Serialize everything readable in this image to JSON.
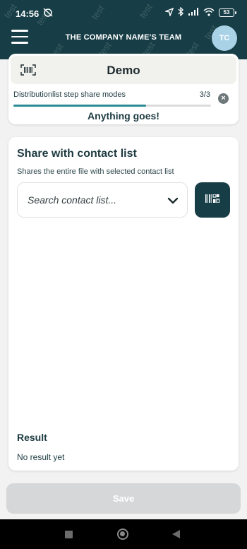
{
  "status_bar": {
    "time": "14:56",
    "battery": "53"
  },
  "header": {
    "title": "THE COMPANY NAME'S TEAM",
    "avatar_initials": "TC",
    "watermark": "test"
  },
  "demo": {
    "title": "Demo",
    "step_label": "Distributionlist step share modes",
    "step_count": "3/3",
    "step_progress": 0.67,
    "message": "Anything goes!"
  },
  "share": {
    "title": "Share with contact list",
    "subtitle": "Shares the entire file with selected contact list",
    "search_placeholder": "Search contact list..."
  },
  "result": {
    "title": "Result",
    "value": "No result yet"
  },
  "footer": {
    "save_label": "Save"
  },
  "colors": {
    "brand": "#173e46",
    "accent": "#2b8a93",
    "avatar": "#a9d2e6",
    "disabled": "#d6d7d8"
  },
  "icons": [
    "hamburger-menu-icon",
    "barcode-icon",
    "close-circle-icon",
    "chevron-down-icon",
    "nav-recents-icon",
    "nav-home-icon",
    "nav-back-icon"
  ]
}
